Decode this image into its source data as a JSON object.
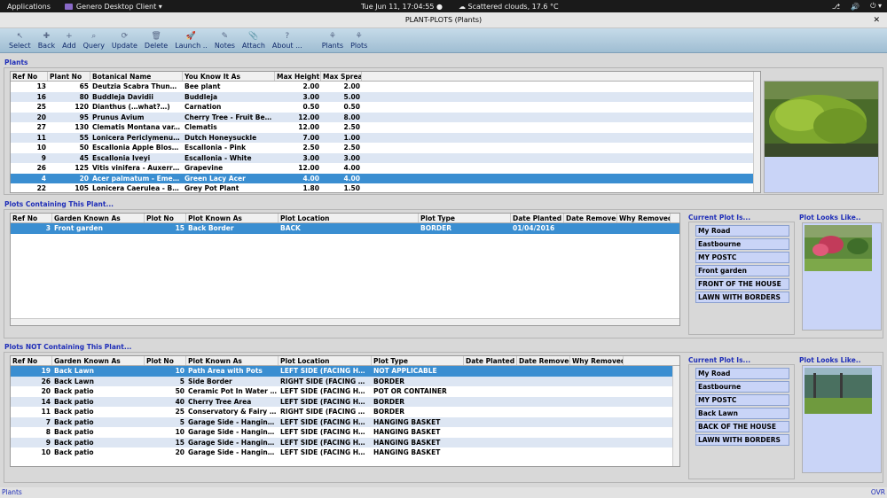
{
  "sysbar": {
    "applications": "Applications",
    "app_menu": "Genero Desktop Client ▾",
    "clock": "Tue Jun 11, 17:04:55 ●",
    "weather": "Scattered clouds, 17.6 °C",
    "tray": [
      "⎇",
      "🔊",
      "⏻ ▾"
    ]
  },
  "window": {
    "title": "PLANT-PLOTS (Plants)",
    "close": "✕"
  },
  "toolbar": [
    {
      "label": "Select",
      "icon": "↖",
      "name": "select"
    },
    {
      "label": "Back",
      "icon": "✚",
      "name": "back"
    },
    {
      "label": "Add",
      "icon": "+",
      "name": "add"
    },
    {
      "label": "Query",
      "icon": "⌕",
      "name": "query"
    },
    {
      "label": "Update",
      "icon": "⟳",
      "name": "update"
    },
    {
      "label": "Delete",
      "icon": "🗑",
      "name": "delete"
    },
    {
      "label": "Launch ..",
      "icon": "🚀",
      "name": "launch"
    },
    {
      "label": "Notes",
      "icon": "✎",
      "name": "notes"
    },
    {
      "label": "Attach",
      "icon": "📎",
      "name": "attach"
    },
    {
      "label": "About ...",
      "icon": "?",
      "name": "about"
    },
    {
      "label": "Plants",
      "icon": "⚘",
      "name": "plants"
    },
    {
      "label": "Plots",
      "icon": "⚘",
      "name": "plots"
    }
  ],
  "plants": {
    "label": "Plants",
    "columns": [
      "Ref No",
      "Plant No",
      "Botanical Name",
      "You Know It As",
      "Max Height",
      "Max Spread"
    ],
    "rows": [
      [
        "13",
        "65",
        "Deutzia Scabra Thunber…",
        "Bee plant",
        "2.00",
        "2.00"
      ],
      [
        "16",
        "80",
        "Buddleja Davidii",
        "Buddleja",
        "3.00",
        "5.00"
      ],
      [
        "25",
        "120",
        "Dianthus (…what?…)",
        "Carnation",
        "0.50",
        "0.50"
      ],
      [
        "20",
        "95",
        "Prunus Avium",
        "Cherry Tree - Fruit Bearing",
        "12.00",
        "8.00"
      ],
      [
        "27",
        "130",
        "Clematis Montana var. W…",
        "Clematis",
        "12.00",
        "2.50"
      ],
      [
        "11",
        "55",
        "Lonicera Periclymenum …",
        "Dutch Honeysuckle",
        "7.00",
        "1.00"
      ],
      [
        "10",
        "50",
        "Escallonia Apple Blossom",
        "Escallonia - Pink",
        "2.50",
        "2.50"
      ],
      [
        "9",
        "45",
        "Escallonia Iveyi",
        "Escallonia - White",
        "3.00",
        "3.00"
      ],
      [
        "26",
        "125",
        "Vitis vinifera - Auxerrois …",
        "Grapevine",
        "12.00",
        "4.00"
      ],
      [
        "4",
        "20",
        "Acer palmatum - Emeral…",
        "Green Lacy Acer",
        "4.00",
        "4.00"
      ],
      [
        "22",
        "105",
        "Lonicera Caerulea - Blue…",
        "Grey Pot Plant",
        "1.80",
        "1.50"
      ]
    ],
    "selected_index": 9
  },
  "containing": {
    "label": "Plots Containing This Plant...",
    "columns": [
      "Ref No",
      "Garden Known As",
      "Plot No",
      "Plot Known As",
      "Plot Location",
      "Plot Type",
      "Date Planted",
      "Date Removed",
      "Why Removed"
    ],
    "rows": [
      [
        "3",
        "Front garden",
        "15",
        "Back Border",
        "BACK",
        "BORDER",
        "01/04/2016",
        "",
        ""
      ]
    ],
    "selected_index": 0,
    "current_title": "Current Plot Is...",
    "looks_title": "Plot Looks Like..",
    "current": [
      "My Road",
      "Eastbourne",
      "MY POSTC",
      "Front garden",
      "FRONT OF THE HOUSE",
      "LAWN WITH BORDERS"
    ]
  },
  "not_containing": {
    "label": "Plots NOT Containing This Plant...",
    "columns": [
      "Ref No",
      "Garden Known As",
      "Plot No",
      "Plot Known As",
      "Plot Location",
      "Plot Type",
      "Date Planted",
      "Date Removed",
      "Why Removed"
    ],
    "rows": [
      [
        "19",
        "Back Lawn",
        "10",
        "Path Area with Pots",
        "LEFT SIDE (FACING HOU…",
        "NOT APPLICABLE",
        "",
        "",
        ""
      ],
      [
        "26",
        "Back Lawn",
        "5",
        "Side Border",
        "RIGHT SIDE  (FACING H…",
        "BORDER",
        "",
        "",
        ""
      ],
      [
        "20",
        "Back patio",
        "50",
        "Ceramic Pot In Water Fe…",
        "LEFT SIDE (FACING HOU…",
        "POT OR CONTAINER",
        "",
        "",
        ""
      ],
      [
        "14",
        "Back patio",
        "40",
        "Cherry Tree Area",
        "LEFT SIDE (FACING HOU…",
        "BORDER",
        "",
        "",
        ""
      ],
      [
        "11",
        "Back patio",
        "25",
        "Conservatory & Fairy ga…",
        "RIGHT SIDE  (FACING H…",
        "BORDER",
        "",
        "",
        ""
      ],
      [
        "7",
        "Back patio",
        "5",
        "Garage Side - Hanging B…",
        "LEFT SIDE (FACING HOU…",
        "HANGING BASKET",
        "",
        "",
        ""
      ],
      [
        "8",
        "Back patio",
        "10",
        "Garage Side - Hanging B…",
        "LEFT SIDE (FACING HOU…",
        "HANGING BASKET",
        "",
        "",
        ""
      ],
      [
        "9",
        "Back patio",
        "15",
        "Garage Side - Hanging B…",
        "LEFT SIDE (FACING HOU…",
        "HANGING BASKET",
        "",
        "",
        ""
      ],
      [
        "10",
        "Back patio",
        "20",
        "Garage Side - Hanging B…",
        "LEFT SIDE (FACING HOU…",
        "HANGING BASKET",
        "",
        "",
        ""
      ]
    ],
    "selected_index": 0,
    "current_title": "Current Plot Is...",
    "looks_title": "Plot Looks Like..",
    "current": [
      "My Road",
      "Eastbourne",
      "MY POSTC",
      "Back Lawn",
      "BACK OF THE HOUSE",
      "LAWN WITH BORDERS"
    ]
  },
  "status": {
    "left": "Plants",
    "right": "OVR"
  },
  "colors": {
    "selected_row": "#3a8ed1",
    "alt_row": "#dde6f3",
    "label_blue": "#1f2eb8",
    "chip_bg": "#c9d4f7"
  }
}
